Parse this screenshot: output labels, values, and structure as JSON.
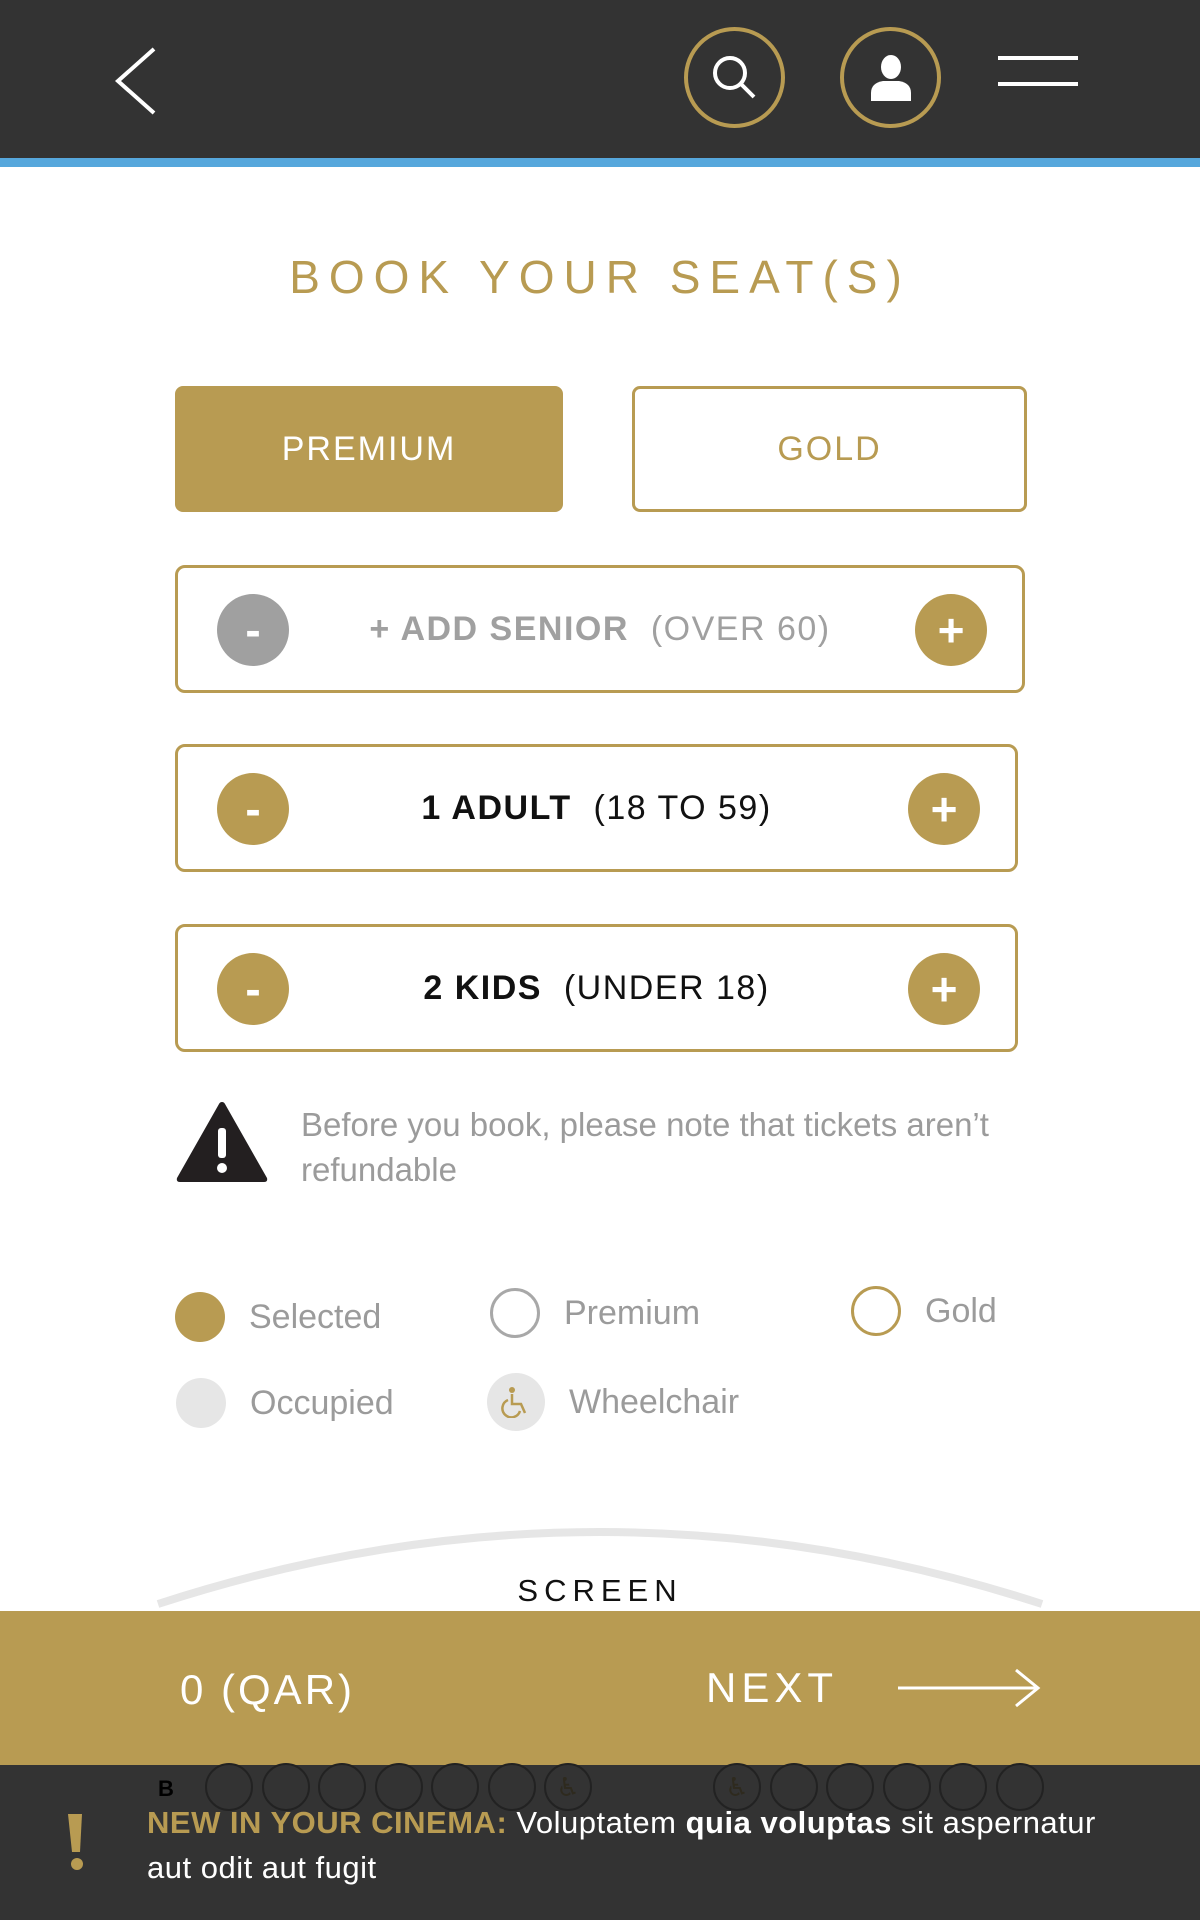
{
  "colors": {
    "accent": "#b89b52",
    "header_bg": "#333333",
    "header_strip": "#56a7dc",
    "muted_text": "#9b9b9b",
    "occupied": "#e6e6e6"
  },
  "header": {
    "back_icon": "chevron-left-icon",
    "search_icon": "search-icon",
    "user_icon": "user-icon",
    "menu_icon": "hamburger-menu-icon"
  },
  "page": {
    "title": "BOOK YOUR SEAT(S)"
  },
  "tabs": [
    {
      "label": "PREMIUM",
      "active": true
    },
    {
      "label": "GOLD",
      "active": false
    }
  ],
  "tickets": [
    {
      "prefix": "+ ADD SENIOR",
      "range": "(OVER 60)",
      "count": 0,
      "enabled": false,
      "minus": "-",
      "plus": "+"
    },
    {
      "prefix": "1 ADULT",
      "range": "(18 TO 59)",
      "count": 1,
      "enabled": true,
      "minus": "-",
      "plus": "+"
    },
    {
      "prefix": "2 KIDS",
      "range": "(UNDER 18)",
      "count": 2,
      "enabled": true,
      "minus": "-",
      "plus": "+"
    }
  ],
  "warning": {
    "icon": "warning-triangle-icon",
    "text": "Before you book, please note that tickets aren’t refundable"
  },
  "legend": [
    {
      "key": "selected",
      "label": "Selected"
    },
    {
      "key": "premium",
      "label": "Premium"
    },
    {
      "key": "gold",
      "label": "Gold"
    },
    {
      "key": "occupied",
      "label": "Occupied"
    },
    {
      "key": "wheelchair",
      "label": "Wheelchair"
    }
  ],
  "screen": {
    "label": "SCREEN"
  },
  "seat_map": {
    "row_label": "B",
    "seats_left": [
      "seat",
      "seat",
      "seat",
      "seat",
      "seat",
      "seat",
      "wheelchair"
    ],
    "seats_right": [
      "wheelchair",
      "seat",
      "seat",
      "seat",
      "seat",
      "seat"
    ]
  },
  "footer": {
    "price": "0 (QAR)",
    "next_label": "NEXT"
  },
  "ticker": {
    "lead": "NEW IN YOUR CINEMA:",
    "text_1": " Voluptatem ",
    "text_bold": "quia voluptas",
    "text_2": " sit aspernatur aut odit aut fugit"
  }
}
